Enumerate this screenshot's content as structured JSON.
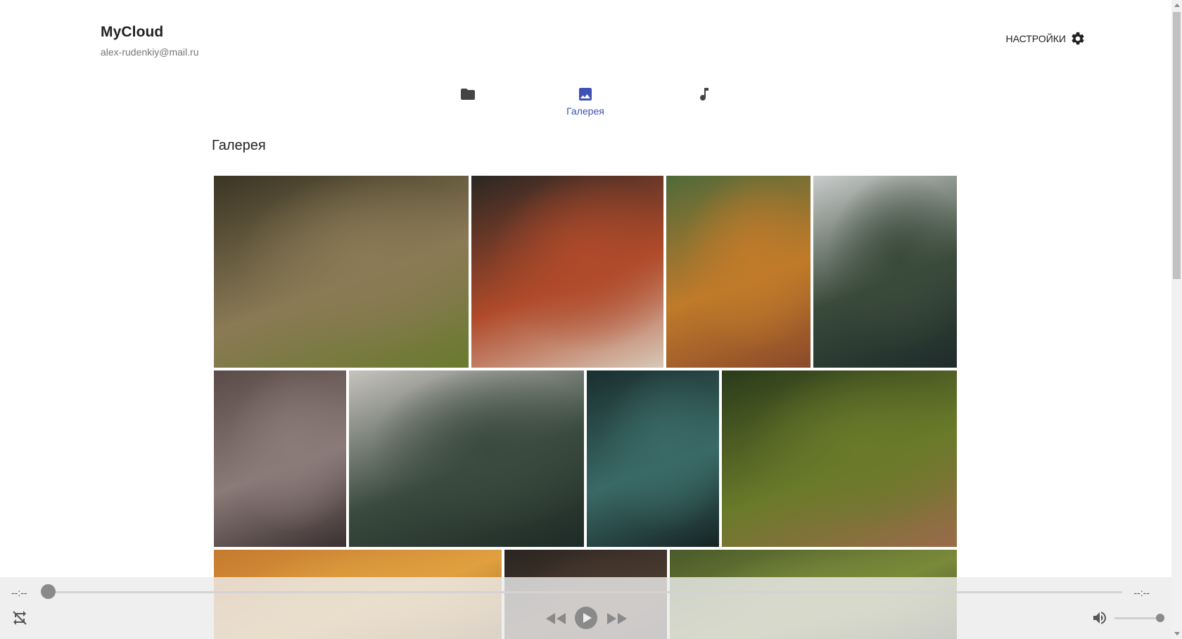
{
  "header": {
    "app_title": "MyCloud",
    "user_email": "alex-rudenkiy@mail.ru",
    "settings_label": "НАСТРОЙКИ"
  },
  "nav": {
    "items": [
      {
        "icon": "folder-icon",
        "label": ""
      },
      {
        "icon": "image-icon",
        "label": "Галерея",
        "active": true
      },
      {
        "icon": "music-note-icon",
        "label": ""
      }
    ]
  },
  "section_title": "Галерея",
  "gallery": {
    "photos": [
      {
        "name": "forest-sunrays",
        "colors": [
          "#3a3424",
          "#8a7a55",
          "#6a7a2e"
        ]
      },
      {
        "name": "red-mushroom",
        "colors": [
          "#2a2724",
          "#b04a2a",
          "#d8c8b8"
        ]
      },
      {
        "name": "autumn-hillside",
        "colors": [
          "#4f6a3a",
          "#c07a2a",
          "#8a4a2a"
        ]
      },
      {
        "name": "misty-lake-forest",
        "colors": [
          "#c9cccb",
          "#3a4a3a",
          "#1e2b2b"
        ]
      },
      {
        "name": "oak-leaves",
        "colors": [
          "#5a4a48",
          "#8a7a78",
          "#3a3030"
        ]
      },
      {
        "name": "foggy-forest",
        "colors": [
          "#c7c3be",
          "#3a4a3e",
          "#1e2a26"
        ]
      },
      {
        "name": "pine-branches",
        "colors": [
          "#1a2e2e",
          "#3a6a66",
          "#162424"
        ]
      },
      {
        "name": "acorn-moss",
        "colors": [
          "#2a3a1a",
          "#6a7a2a",
          "#9a6a4a"
        ]
      },
      {
        "name": "autumn-canopy",
        "colors": [
          "#c57a2e",
          "#e0a040",
          "#8a5a20"
        ]
      },
      {
        "name": "dark-woods",
        "colors": [
          "#2a2420",
          "#4a3a30",
          "#3a2e28"
        ]
      },
      {
        "name": "forest-path",
        "colors": [
          "#4a5a2a",
          "#7a8a3a",
          "#3a3a1e"
        ]
      }
    ]
  },
  "player": {
    "current_time": "--:--",
    "duration": "--:--",
    "progress": 0,
    "volume": 1.0
  }
}
